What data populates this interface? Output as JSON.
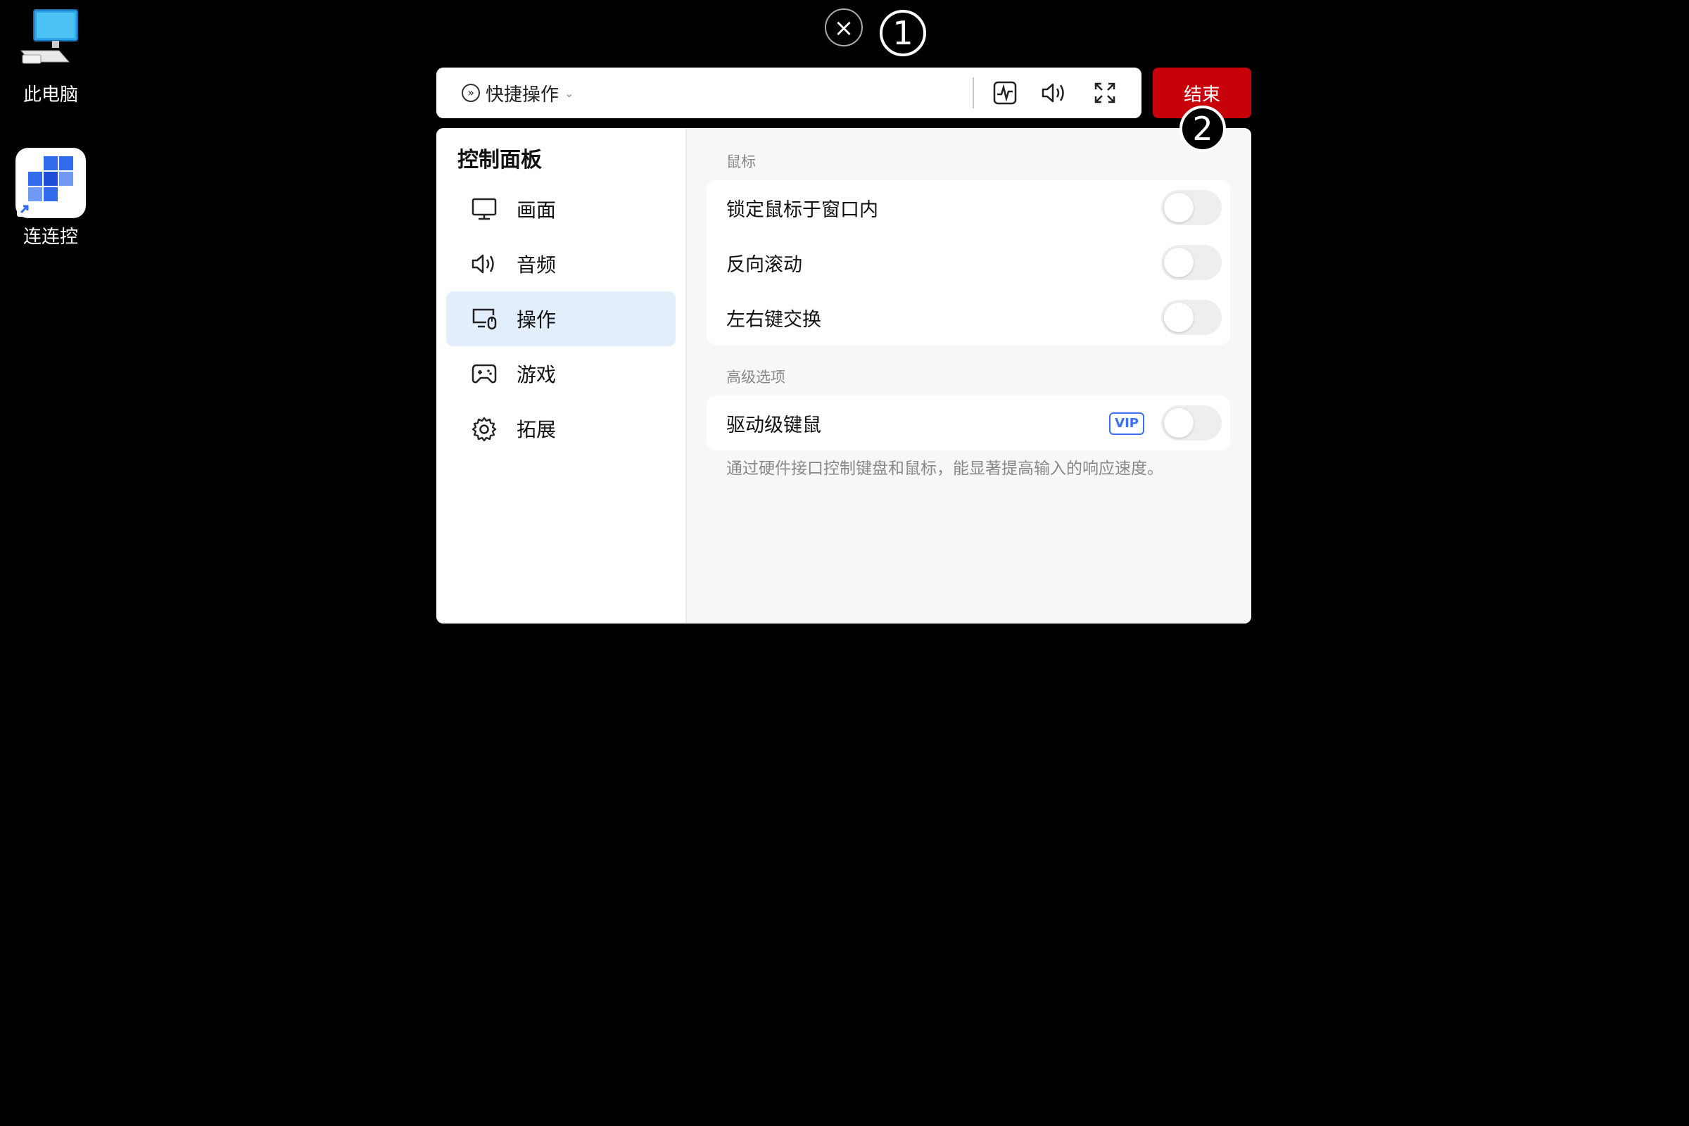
{
  "desktop": {
    "icons": [
      {
        "label": "此电脑",
        "icon": "computer-icon"
      },
      {
        "label": "连连控",
        "icon": "app-logo-icon"
      }
    ]
  },
  "overlay": {
    "close_glyph": "×",
    "marker_1": "1",
    "marker_2": "2"
  },
  "toolbar": {
    "quick_actions_label": "快捷操作",
    "quick_actions_glyph": "»",
    "chevron": "⌄",
    "end_label": "结束"
  },
  "panel": {
    "title": "控制面板",
    "nav": [
      {
        "label": "画面",
        "icon": "monitor-icon",
        "active": false
      },
      {
        "label": "音频",
        "icon": "speaker-icon",
        "active": false
      },
      {
        "label": "操作",
        "icon": "mouse-monitor-icon",
        "active": true
      },
      {
        "label": "游戏",
        "icon": "gamepad-icon",
        "active": false
      },
      {
        "label": "拓展",
        "icon": "gear-icon",
        "active": false
      }
    ],
    "sections": {
      "mouse": {
        "label": "鼠标",
        "rows": [
          {
            "label": "锁定鼠标于窗口内",
            "enabled": false
          },
          {
            "label": "反向滚动",
            "enabled": false
          },
          {
            "label": "左右键交换",
            "enabled": false
          }
        ]
      },
      "advanced": {
        "label": "高级选项",
        "rows": [
          {
            "label": "驱动级键鼠",
            "badge": "VIP",
            "enabled": false
          }
        ],
        "description": "通过硬件接口控制键盘和鼠标，能显著提高输入的响应速度。"
      }
    }
  },
  "colors": {
    "accent_red": "#c8000a",
    "active_nav_bg": "#e3eefc",
    "vip_blue": "#3b6ff2"
  }
}
